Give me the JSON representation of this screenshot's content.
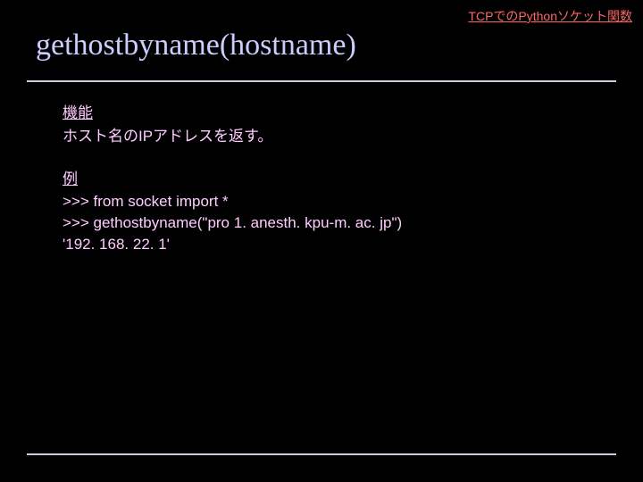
{
  "header": {
    "topic": "TCPでのPythonソケット関数",
    "title": "gethostbyname(hostname)"
  },
  "body": {
    "function_section_title": "機能",
    "function_description": "ホスト名のIPアドレスを返す。",
    "example_section_title": "例",
    "example_lines": [
      ">>> from socket import *",
      ">>> gethostbyname(\"pro 1. anesth. kpu-m. ac. jp\")",
      "'192. 168. 22. 1'"
    ]
  }
}
